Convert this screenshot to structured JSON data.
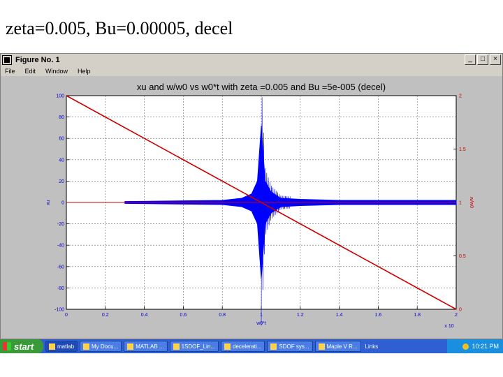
{
  "slide": {
    "title": "zeta=0.005, Bu=0.00005, decel"
  },
  "window": {
    "title": "Figure No. 1",
    "minimize": "_",
    "maximize": "□",
    "close": "×",
    "menu": [
      "File",
      "Edit",
      "Window",
      "Help"
    ]
  },
  "chart_data": {
    "type": "line",
    "title": "xu and w/w0 vs w0*t with zeta =0.005 and Bu =5e-005 (decel)",
    "xlabel": "w0*t",
    "ylabel": "xu",
    "y2label": "w/w0",
    "x_exponent": "x 10",
    "xlim": [
      0,
      2
    ],
    "ylim": [
      -100,
      100
    ],
    "y2lim": [
      0,
      2
    ],
    "xticks": [
      0,
      0.2,
      0.4,
      0.6,
      0.8,
      1,
      1.2,
      1.4,
      1.6,
      1.8,
      2
    ],
    "xtick_labels": [
      "0",
      "0.2",
      "0.4",
      "0.6",
      "0.8",
      "1",
      "1.2",
      "1.4",
      "1.6",
      "1.8",
      "2"
    ],
    "yticks": [
      100,
      80,
      60,
      40,
      20,
      0,
      -20,
      -40,
      -60,
      -80,
      -100
    ],
    "ytick_labels": [
      "100",
      "80",
      "60",
      "40",
      "20",
      "0",
      "-20",
      "-40",
      "-60",
      "-80",
      "-100"
    ],
    "y2ticks": [
      2,
      1.5,
      1,
      0.5,
      0
    ],
    "y2tick_labels": [
      "2",
      "1.5",
      "1",
      "0.5",
      "0"
    ],
    "grid": true,
    "series": [
      {
        "role": "xu response",
        "axis": "left",
        "color": "#0000ff",
        "x": [
          0.3,
          0.8,
          0.9,
          0.95,
          0.98,
          1.0,
          1.02,
          1.05,
          1.1,
          1.2,
          1.4,
          1.6,
          1.8,
          2.0
        ],
        "envelope_upper": [
          1,
          2,
          4,
          8,
          20,
          72,
          20,
          10,
          4,
          3,
          2,
          2,
          2,
          2
        ],
        "envelope_lower": [
          -1,
          -2,
          -4,
          -8,
          -20,
          -72,
          -20,
          -10,
          -4,
          -3,
          -2,
          -2,
          -2,
          -2
        ]
      },
      {
        "role": "w/w0 sweep",
        "axis": "right",
        "color": "#cc0000",
        "x": [
          0,
          2
        ],
        "y": [
          2,
          0
        ]
      },
      {
        "role": "reference",
        "axis": "left",
        "color": "#cc0000",
        "x": [
          0,
          2
        ],
        "y": [
          0,
          0
        ]
      }
    ]
  },
  "taskbar": {
    "start": "start",
    "items": [
      {
        "label": "matlab"
      },
      {
        "label": "My Docu..."
      },
      {
        "label": "MATLAB ..."
      },
      {
        "label": "1SDOF_Lin..."
      },
      {
        "label": "decelerati..."
      },
      {
        "label": "SDOF sys..."
      },
      {
        "label": "Maple V R..."
      }
    ],
    "links": "Links",
    "clock": "10:21 PM"
  }
}
